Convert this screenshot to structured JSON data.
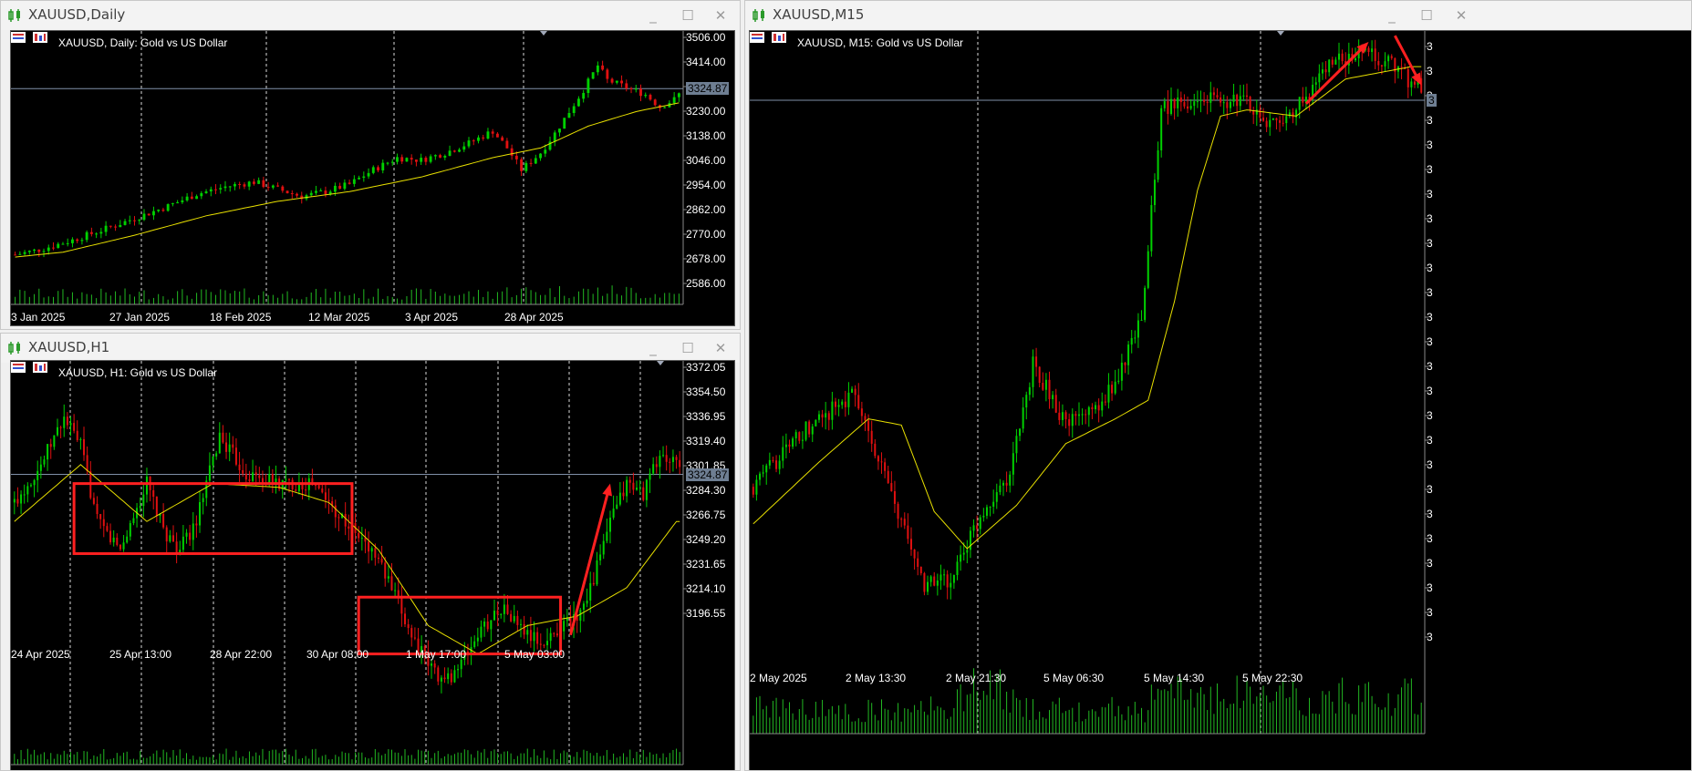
{
  "windows": {
    "daily": {
      "title": "XAUUSD,Daily",
      "overlay": "XAUUSD, Daily:  Gold vs US Dollar",
      "current_price": "3324.87",
      "price_axis": [
        "3506.00",
        "3414.00",
        "3322.00",
        "3230.00",
        "3138.00",
        "3046.00",
        "2954.00",
        "2862.00",
        "2770.00",
        "2678.00",
        "2586.00"
      ],
      "date_axis": [
        "3 Jan 2025",
        "27 Jan 2025",
        "18 Feb 2025",
        "12 Mar 2025",
        "3 Apr 2025",
        "28 Apr 2025"
      ]
    },
    "h1": {
      "title": "XAUUSD,H1",
      "overlay": "XAUUSD, H1:  Gold vs US Dollar",
      "current_price": "3324.87",
      "price_axis": [
        "3372.05",
        "3354.50",
        "3336.95",
        "3319.40",
        "3301.85",
        "3284.30",
        "3266.75",
        "3249.20",
        "3231.65",
        "3214.10",
        "3196.55"
      ],
      "date_axis": [
        "24 Apr 2025",
        "25 Apr 13:00",
        "28 Apr 22:00",
        "30 Apr 08:00",
        "1 May 17:00",
        "5 May 03:00"
      ]
    },
    "m15": {
      "title": "XAUUSD,M15",
      "overlay": "XAUUSD, M15:  Gold vs US Dollar",
      "current_price": "3",
      "price_axis": [
        "3",
        "3",
        "3",
        "3",
        "3",
        "3",
        "3",
        "3",
        "3",
        "3",
        "3",
        "3",
        "3",
        "3",
        "3",
        "3",
        "3",
        "3",
        "3",
        "3",
        "3",
        "3",
        "3",
        "3",
        "3"
      ],
      "date_axis": [
        "2 May 2025",
        "2 May 13:30",
        "2 May 21:30",
        "5 May 06:30",
        "5 May 14:30",
        "5 May 22:30"
      ]
    }
  },
  "window_controls": {
    "minimize": "_",
    "maximize": "☐",
    "close": "✕"
  },
  "colors": {
    "bull": "#00d000",
    "bear": "#e01010",
    "ma": "#e8e000",
    "volume": "#22b822",
    "annotation": "#ff2020"
  },
  "chart_data": [
    {
      "type": "candlestick",
      "timeframe": "Daily",
      "symbol": "XAUUSD",
      "ylim": [
        2540,
        3540
      ],
      "x_ticks": [
        "3 Jan 2025",
        "27 Jan 2025",
        "18 Feb 2025",
        "12 Mar 2025",
        "3 Apr 2025",
        "28 Apr 2025"
      ],
      "current_price": 3324.87,
      "anchors": [
        [
          0,
          2640
        ],
        [
          5,
          2660
        ],
        [
          12,
          2700
        ],
        [
          18,
          2740
        ],
        [
          25,
          2790
        ],
        [
          32,
          2840
        ],
        [
          38,
          2890
        ],
        [
          44,
          2920
        ],
        [
          50,
          2940
        ],
        [
          55,
          2910
        ],
        [
          60,
          2880
        ],
        [
          65,
          2900
        ],
        [
          70,
          2930
        ],
        [
          75,
          2990
        ],
        [
          80,
          3040
        ],
        [
          85,
          3030
        ],
        [
          90,
          3060
        ],
        [
          95,
          3100
        ],
        [
          100,
          3150
        ],
        [
          103,
          3080
        ],
        [
          106,
          2990
        ],
        [
          110,
          3060
        ],
        [
          113,
          3140
        ],
        [
          116,
          3230
        ],
        [
          119,
          3320
        ],
        [
          122,
          3420
        ],
        [
          124,
          3360
        ],
        [
          128,
          3330
        ],
        [
          132,
          3300
        ],
        [
          135,
          3250
        ],
        [
          138,
          3280
        ],
        [
          140,
          3324
        ]
      ],
      "ma_anchors": [
        [
          0,
          2630
        ],
        [
          10,
          2650
        ],
        [
          25,
          2720
        ],
        [
          40,
          2800
        ],
        [
          55,
          2860
        ],
        [
          70,
          2900
        ],
        [
          85,
          2960
        ],
        [
          100,
          3040
        ],
        [
          110,
          3080
        ],
        [
          120,
          3170
        ],
        [
          130,
          3230
        ],
        [
          140,
          3270
        ]
      ]
    },
    {
      "type": "candlestick",
      "timeframe": "H1",
      "symbol": "XAUUSD",
      "ylim": [
        3185,
        3380
      ],
      "x_ticks": [
        "24 Apr 2025",
        "25 Apr 13:00",
        "28 Apr 22:00",
        "30 Apr 08:00",
        "1 May 17:00",
        "5 May 03:00"
      ],
      "current_price": 3324.87,
      "anchors": [
        [
          0,
          3310
        ],
        [
          8,
          3330
        ],
        [
          15,
          3355
        ],
        [
          20,
          3340
        ],
        [
          25,
          3300
        ],
        [
          32,
          3285
        ],
        [
          40,
          3320
        ],
        [
          45,
          3295
        ],
        [
          50,
          3285
        ],
        [
          55,
          3300
        ],
        [
          62,
          3345
        ],
        [
          70,
          3325
        ],
        [
          80,
          3320
        ],
        [
          90,
          3320
        ],
        [
          100,
          3300
        ],
        [
          105,
          3290
        ],
        [
          110,
          3280
        ],
        [
          115,
          3260
        ],
        [
          120,
          3240
        ],
        [
          125,
          3225
        ],
        [
          130,
          3215
        ],
        [
          135,
          3225
        ],
        [
          140,
          3240
        ],
        [
          147,
          3255
        ],
        [
          155,
          3240
        ],
        [
          160,
          3235
        ],
        [
          165,
          3245
        ],
        [
          170,
          3250
        ],
        [
          175,
          3270
        ],
        [
          180,
          3300
        ],
        [
          185,
          3320
        ],
        [
          190,
          3315
        ],
        [
          195,
          3335
        ],
        [
          200,
          3330
        ]
      ],
      "ma_anchors": [
        [
          0,
          3300
        ],
        [
          20,
          3330
        ],
        [
          40,
          3300
        ],
        [
          60,
          3320
        ],
        [
          80,
          3318
        ],
        [
          95,
          3310
        ],
        [
          110,
          3285
        ],
        [
          125,
          3245
        ],
        [
          140,
          3230
        ],
        [
          155,
          3245
        ],
        [
          170,
          3250
        ],
        [
          185,
          3265
        ],
        [
          200,
          3300
        ]
      ],
      "annotations": [
        {
          "type": "rectangle",
          "from_candle": 18,
          "to_candle": 102,
          "price_top": 3320,
          "price_bottom": 3283
        },
        {
          "type": "rectangle",
          "from_candle": 104,
          "to_candle": 165,
          "price_top": 3260,
          "price_bottom": 3230
        },
        {
          "type": "arrow",
          "from": [
            168,
            3240
          ],
          "to": [
            180,
            3320
          ]
        }
      ]
    },
    {
      "type": "candlestick",
      "timeframe": "M15",
      "symbol": "XAUUSD",
      "ylim": [
        0,
        1000
      ],
      "x_ticks": [
        "2 May 2025",
        "2 May 13:30",
        "2 May 21:30",
        "5 May 06:30",
        "5 May 14:30",
        "5 May 22:30"
      ],
      "anchors": [
        [
          0,
          280
        ],
        [
          15,
          370
        ],
        [
          30,
          430
        ],
        [
          35,
          370
        ],
        [
          45,
          220
        ],
        [
          52,
          120
        ],
        [
          60,
          130
        ],
        [
          70,
          240
        ],
        [
          78,
          300
        ],
        [
          85,
          480
        ],
        [
          95,
          380
        ],
        [
          105,
          410
        ],
        [
          112,
          470
        ],
        [
          118,
          560
        ],
        [
          124,
          890
        ],
        [
          135,
          910
        ],
        [
          150,
          900
        ],
        [
          160,
          860
        ],
        [
          175,
          960
        ],
        [
          185,
          990
        ],
        [
          195,
          960
        ],
        [
          200,
          930
        ]
      ],
      "ma_anchors": [
        [
          0,
          220
        ],
        [
          20,
          320
        ],
        [
          35,
          390
        ],
        [
          45,
          380
        ],
        [
          55,
          240
        ],
        [
          65,
          180
        ],
        [
          80,
          250
        ],
        [
          95,
          350
        ],
        [
          110,
          390
        ],
        [
          120,
          420
        ],
        [
          128,
          580
        ],
        [
          135,
          760
        ],
        [
          142,
          880
        ],
        [
          150,
          890
        ],
        [
          165,
          880
        ],
        [
          180,
          940
        ],
        [
          200,
          960
        ]
      ],
      "annotations": [
        {
          "type": "arrow",
          "from": [
            168,
            900
          ],
          "to": [
            187,
            1000
          ]
        },
        {
          "type": "arrow",
          "from": [
            195,
            1010
          ],
          "to": [
            203,
            930
          ]
        }
      ]
    }
  ]
}
